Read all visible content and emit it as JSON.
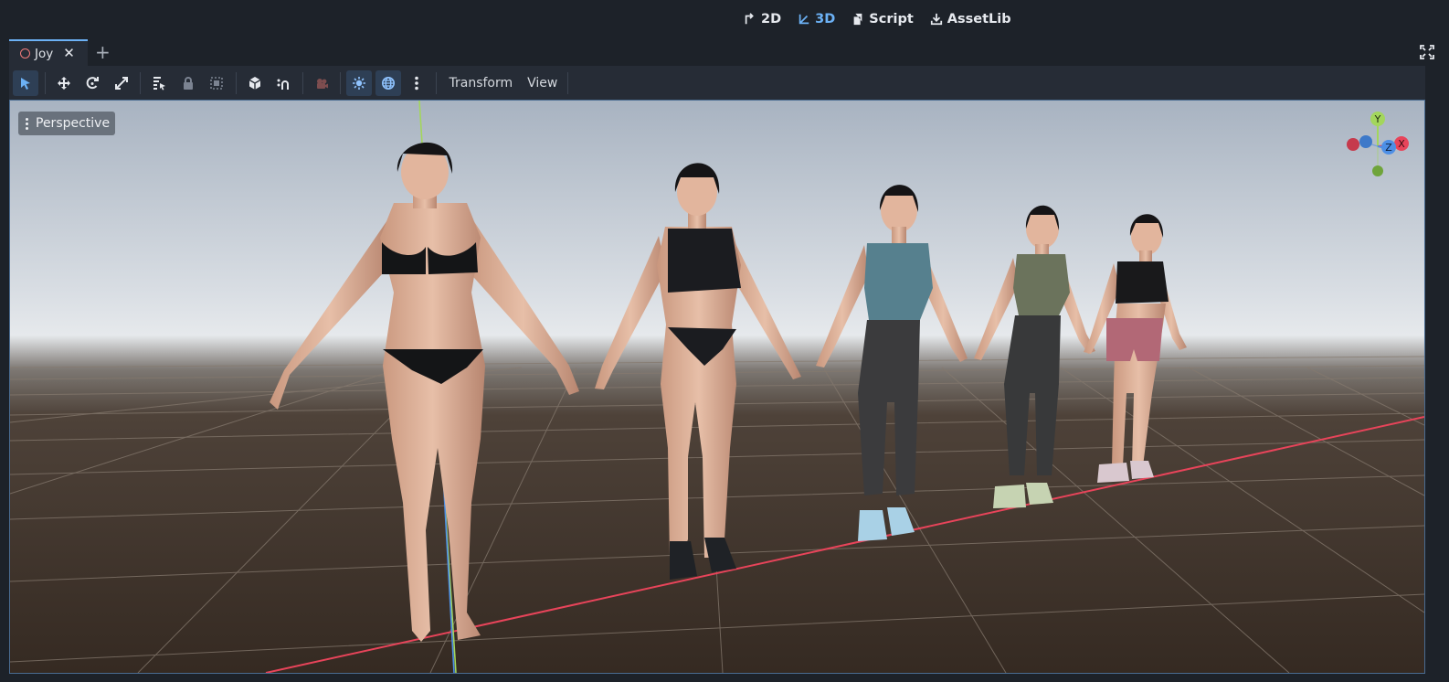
{
  "editor": {
    "modes": [
      {
        "label": "2D",
        "icon": "2d-icon",
        "active": false
      },
      {
        "label": "3D",
        "icon": "3d-icon",
        "active": true
      },
      {
        "label": "Script",
        "icon": "script-icon",
        "active": false
      },
      {
        "label": "AssetLib",
        "icon": "assetlib-icon",
        "active": false
      }
    ]
  },
  "scene_tabs": {
    "active_tab": "Joy",
    "add_label": "+"
  },
  "toolbar": {
    "menus": [
      "Transform",
      "View"
    ],
    "tools": [
      "select-tool-icon",
      "move-tool-icon",
      "rotate-tool-icon",
      "scale-tool-icon",
      "list-select-icon",
      "lock-icon",
      "group-icon",
      "local-space-icon",
      "snap-icon",
      "camera-icon",
      "preview-sun-icon",
      "preview-environment-icon",
      "more-icon"
    ]
  },
  "viewport": {
    "camera_label": "Perspective",
    "gizmo_axes": {
      "y": "Y",
      "x": "X",
      "z": "Z"
    },
    "colors": {
      "sky_top": "#a9b4c2",
      "horizon": "#e2e6ea",
      "ground": "#3b2f27",
      "grid": "#80786e",
      "x_axis": "#e8445a",
      "y_axis": "#a3d65c",
      "z_axis": "#4d8fe6"
    },
    "characters": [
      {
        "name": "character-1",
        "outfit": "black-bikini",
        "top": "#141517",
        "bottom": "#141517",
        "shoes": "none"
      },
      {
        "name": "character-2",
        "outfit": "sports-set",
        "top": "#1b1c20",
        "bottom": "#1b1c20",
        "shoes": "#1f2226"
      },
      {
        "name": "character-3",
        "outfit": "teal-tank-leggings",
        "top": "#56808e",
        "bottom": "#3b3b3d",
        "shoes": "#a9d1e6"
      },
      {
        "name": "character-4",
        "outfit": "olive-tank-leggings",
        "top": "#6b735c",
        "bottom": "#38393a",
        "shoes": "#c6d3b2"
      },
      {
        "name": "character-5",
        "outfit": "crop-top-shorts",
        "top": "#19191b",
        "bottom": "#b26876",
        "shoes": "#d9c8cf"
      }
    ]
  }
}
